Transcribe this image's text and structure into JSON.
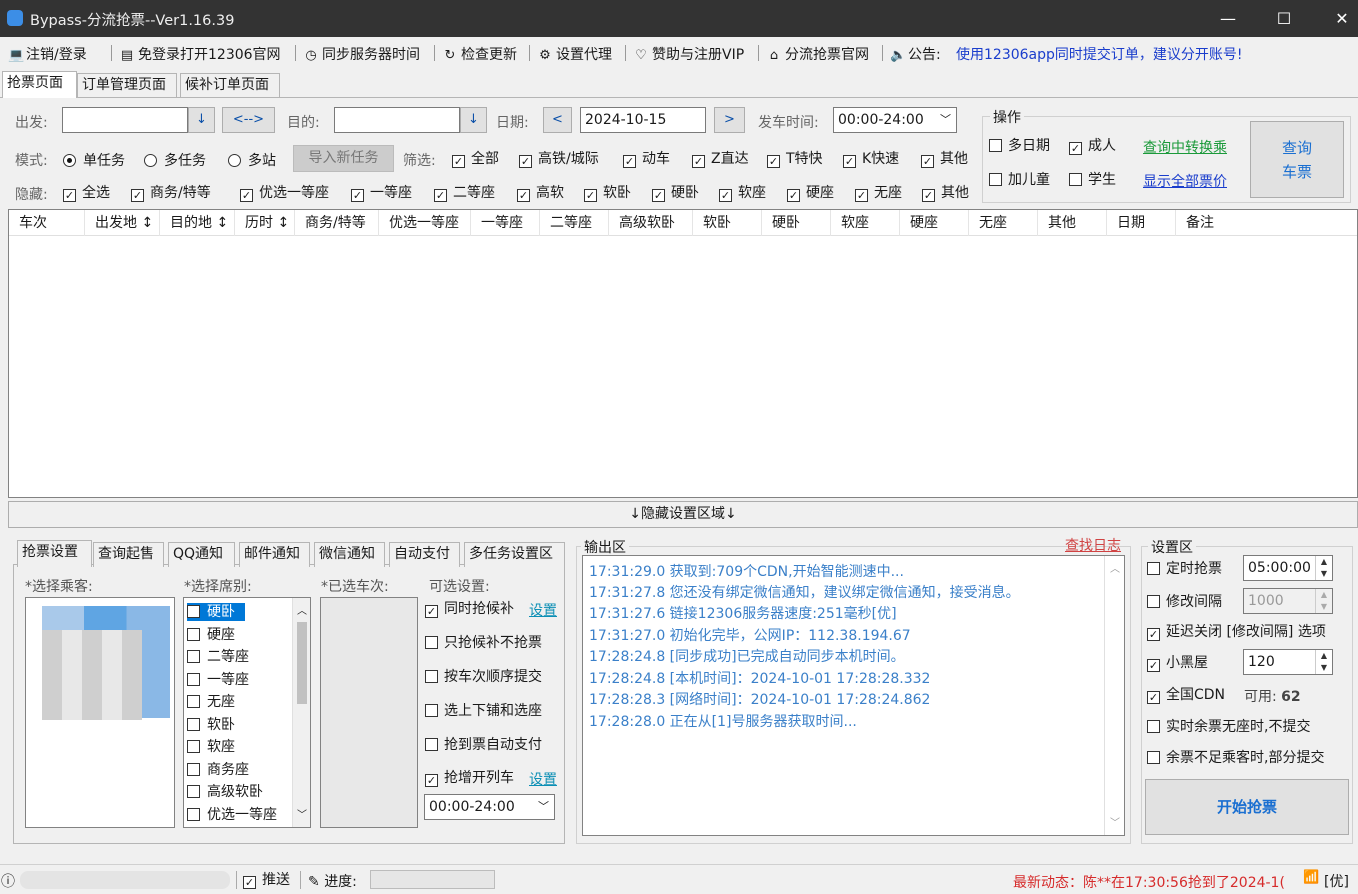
{
  "window": {
    "title": "Bypass-分流抢票--Ver1.16.39",
    "minimize": "—",
    "maximize": "☐",
    "close": "✕"
  },
  "menu": [
    {
      "icon": "💻",
      "icon_name": "computer-icon",
      "label": "注销/登录"
    },
    {
      "icon": "▤",
      "icon_name": "browser-icon",
      "label": "免登录打开12306官网"
    },
    {
      "icon": "◷",
      "icon_name": "clock-icon",
      "label": "同步服务器时间"
    },
    {
      "icon": "↻",
      "icon_name": "refresh-icon",
      "label": "检查更新"
    },
    {
      "icon": "⚙",
      "icon_name": "gear-icon",
      "label": "设置代理"
    },
    {
      "icon": "♡",
      "icon_name": "heart-icon",
      "label": "赞助与注册VIP"
    },
    {
      "icon": "⌂",
      "icon_name": "home-icon",
      "label": "分流抢票官网"
    },
    {
      "icon": "🔈",
      "icon_name": "speaker-icon",
      "label": "公告:"
    }
  ],
  "notice_text": "使用12306app同时提交订单，建议分开账号!",
  "main_tabs": [
    "抢票页面",
    "订单管理页面",
    "候补订单页面"
  ],
  "query": {
    "from_label": "出发:",
    "from_value": "",
    "from_drop": "↓",
    "swap_label": "<-->",
    "to_label": "目的:",
    "to_value": "",
    "to_drop": "↓",
    "date_label": "日期:",
    "date_prev": "<",
    "date_value": "2024-10-15",
    "date_next": ">",
    "time_label": "发车时间:",
    "time_value": "00:00-24:00"
  },
  "mode": {
    "label": "模式:",
    "options": [
      {
        "label": "单任务",
        "selected": true
      },
      {
        "label": "多任务",
        "selected": false
      },
      {
        "label": "多站",
        "selected": false
      }
    ],
    "import_button": "导入新任务"
  },
  "filter": {
    "label": "筛选:",
    "items": [
      {
        "label": "全部",
        "checked": true
      },
      {
        "label": "高铁/城际",
        "checked": true
      },
      {
        "label": "动车",
        "checked": true
      },
      {
        "label": "Z直达",
        "checked": true
      },
      {
        "label": "T特快",
        "checked": true
      },
      {
        "label": "K快速",
        "checked": true
      },
      {
        "label": "其他",
        "checked": true
      }
    ]
  },
  "hide": {
    "label": "隐藏:",
    "items": [
      {
        "label": "全选",
        "checked": true
      },
      {
        "label": "商务/特等",
        "checked": true
      },
      {
        "label": "优选一等座",
        "checked": true
      },
      {
        "label": "一等座",
        "checked": true
      },
      {
        "label": "二等座",
        "checked": true
      },
      {
        "label": "高软",
        "checked": true
      },
      {
        "label": "软卧",
        "checked": true
      },
      {
        "label": "硬卧",
        "checked": true
      },
      {
        "label": "软座",
        "checked": true
      },
      {
        "label": "硬座",
        "checked": true
      },
      {
        "label": "无座",
        "checked": true
      },
      {
        "label": "其他",
        "checked": true
      }
    ]
  },
  "ops": {
    "title": "操作",
    "multi_date": {
      "label": "多日期",
      "checked": false
    },
    "adult": {
      "label": "成人",
      "checked": true
    },
    "child": {
      "label": "加儿童",
      "checked": false
    },
    "student": {
      "label": "学生",
      "checked": false
    },
    "transfer_link": "查询中转换乘",
    "show_all_link": "显示全部票价",
    "query_btn_line1": "查询",
    "query_btn_line2": "车票"
  },
  "grid_columns": [
    "车次",
    "出发地 ↕",
    "目的地 ↕",
    "历时 ↕",
    "商务/特等",
    "优选一等座",
    "一等座",
    "二等座",
    "高级软卧",
    "软卧",
    "硬卧",
    "软座",
    "硬座",
    "无座",
    "其他",
    "日期",
    "备注"
  ],
  "hide_settings_bar": "↓隐藏设置区域↓",
  "settings_tabs": [
    "抢票设置",
    "查询起售",
    "QQ通知",
    "邮件通知",
    "微信通知",
    "自动支付",
    "多任务设置区"
  ],
  "passenger_label": "*选择乘客:",
  "seat_label": "*选择席别:",
  "seats": [
    {
      "label": "硬卧",
      "selected": true
    },
    {
      "label": "硬座"
    },
    {
      "label": "二等座"
    },
    {
      "label": "一等座"
    },
    {
      "label": "无座"
    },
    {
      "label": "软卧"
    },
    {
      "label": "软座"
    },
    {
      "label": "商务座"
    },
    {
      "label": "高级软卧"
    },
    {
      "label": "优选一等座"
    }
  ],
  "trains_label": "*已选车次:",
  "optional": {
    "title": "可选设置:",
    "items": [
      {
        "label": "同时抢候补",
        "checked": true,
        "link": "设置"
      },
      {
        "label": "只抢候补不抢票",
        "checked": false
      },
      {
        "label": "按车次顺序提交",
        "checked": false
      },
      {
        "label": "选上下铺和选座",
        "checked": false
      },
      {
        "label": "抢到票自动支付",
        "checked": false
      },
      {
        "label": "抢增开列车",
        "checked": true,
        "link": "设置"
      }
    ],
    "time_value": "00:00-24:00"
  },
  "output": {
    "title": "输出区",
    "find_log": "查找日志",
    "lines": [
      "17:31:29.0  获取到:709个CDN,开始智能测速中...",
      "17:31:27.8  您还没有绑定微信通知，建议绑定微信通知，接受消息。",
      "17:31:27.6  链接12306服务器速度:251毫秒[优]",
      "17:31:27.0  初始化完毕，公网IP：112.38.194.67",
      "17:28:24.8  [同步成功]已完成自动同步本机时间。",
      "17:28:24.8  [本机时间]：2024-10-01 17:28:28.332",
      "17:28:28.3  [网络时间]：2024-10-01 17:28:24.862",
      "17:28:28.0  正在从[1]号服务器获取时间..."
    ]
  },
  "settings": {
    "title": "设置区",
    "timed": {
      "label": "定时抢票",
      "checked": false,
      "value": "05:00:00"
    },
    "interval": {
      "label": "修改间隔",
      "checked": false,
      "value": "1000"
    },
    "delay_close": {
      "label": "延迟关闭 [修改间隔] 选项",
      "checked": true
    },
    "blackroom": {
      "label": "小黑屋",
      "checked": true,
      "value": "120"
    },
    "cdn": {
      "label": "全国CDN",
      "checked": true,
      "avail_label": "可用:",
      "avail_value": "62"
    },
    "no_seat": {
      "label": "实时余票无座时,不提交",
      "checked": false
    },
    "partial": {
      "label": "余票不足乘客时,部分提交",
      "checked": false
    },
    "start_button": "开始抢票"
  },
  "status": {
    "info_icon": "ⓘ",
    "push_label": "推送",
    "push_checked": true,
    "progress_label": "进度:",
    "progress": 0,
    "news": "最新动态：陈**在17:30:56抢到了2024-1(",
    "wifi_icon": "📶",
    "signal": "[优]"
  }
}
